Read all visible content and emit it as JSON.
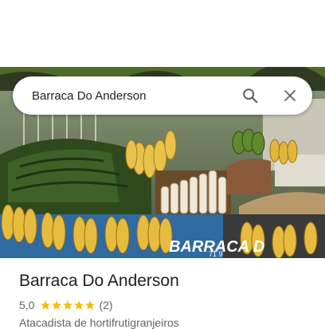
{
  "search": {
    "query": "Barraca Do Anderson"
  },
  "icons": {
    "search": "search-icon",
    "close": "close-icon",
    "star": "star-icon"
  },
  "place": {
    "name": "Barraca Do Anderson",
    "rating": "5,0",
    "stars": 5,
    "review_count": "(2)",
    "category": "Atacadista de hortifrutigranjeiros"
  },
  "photo": {
    "sign_text": "BARRACA D",
    "sign_sub": "71 9"
  },
  "colors": {
    "star": "#fbbc04",
    "text_primary": "#202124",
    "text_secondary": "#5f6368",
    "icon": "#5f6368"
  }
}
